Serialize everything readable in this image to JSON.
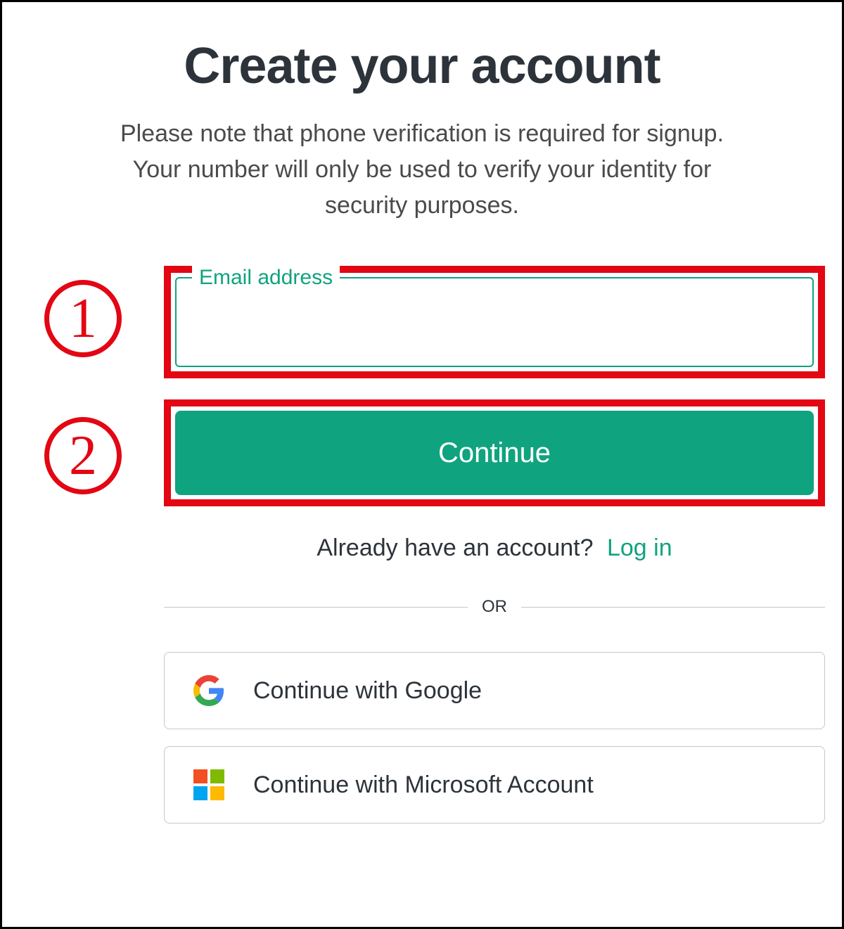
{
  "title": "Create your account",
  "subtitle": "Please note that phone verification is required for signup. Your number will only be used to verify your identity for security purposes.",
  "email": {
    "label": "Email address",
    "value": ""
  },
  "continue_label": "Continue",
  "login_prompt": "Already have an account?",
  "login_link": "Log in",
  "or_label": "OR",
  "sso": {
    "google": "Continue with Google",
    "microsoft": "Continue with Microsoft Account"
  },
  "annotations": {
    "one": "1",
    "two": "2"
  }
}
